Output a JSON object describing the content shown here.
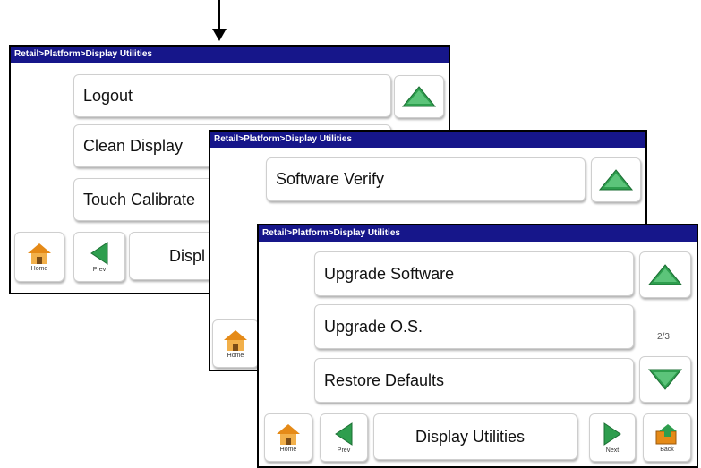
{
  "panel1": {
    "title": "Retail>Platform>Display Utilities",
    "items": [
      "Logout",
      "Clean Display",
      "Touch Calibrate"
    ],
    "footer_title": "Displ",
    "home_label": "Home",
    "prev_label": "Prev"
  },
  "panel2": {
    "title": "Retail>Platform>Display Utilities",
    "items": [
      "Software Verify"
    ],
    "home_label": "Home"
  },
  "panel3": {
    "title": "Retail>Platform>Display Utilities",
    "items": [
      "Upgrade Software",
      "Upgrade O.S.",
      "Restore Defaults"
    ],
    "page_indicator": "2/3",
    "footer_title": "Display Utilities",
    "home_label": "Home",
    "prev_label": "Prev",
    "next_label": "Next",
    "back_label": "Back"
  },
  "colors": {
    "titlebar": "#16168a",
    "arrow_green": "#2e9e4e",
    "home_orange": "#e58a17"
  }
}
